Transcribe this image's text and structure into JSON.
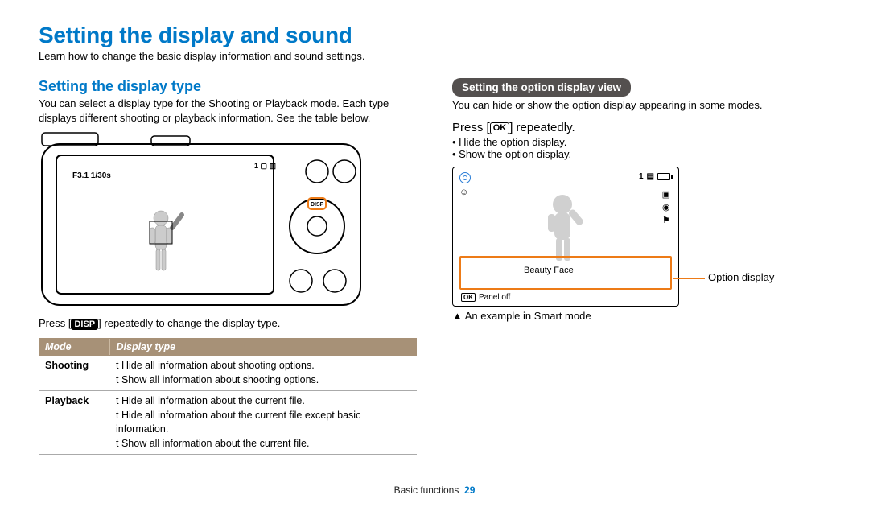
{
  "title": "Setting the display and sound",
  "lead": "Learn how to change the basic display information and sound settings.",
  "left": {
    "subhead": "Setting the display type",
    "para": "You can select a display type for the Shooting or Playback mode. Each type displays different shooting or playback information. See the table below.",
    "camera_overlay": "F3.1 1/30s",
    "disp_label": "DISP",
    "caption_suffix": "] repeatedly to change the display type.",
    "caption_prefix": "Press [",
    "table": {
      "head_mode": "Mode",
      "head_display": "Display type",
      "rows": [
        {
          "mode": "Shooting",
          "items": [
            "Hide all information about shooting options.",
            "Show all information about shooting options."
          ]
        },
        {
          "mode": "Playback",
          "items": [
            "Hide all information about the current file.",
            "Hide all information about the current file except basic information.",
            "Show all information about the current file."
          ]
        }
      ]
    }
  },
  "right": {
    "badge": "Setting the option display view",
    "para": "You can hide or show the option display appearing in some modes.",
    "press_prefix": "Press [",
    "ok_label": "OK",
    "press_suffix": "] repeatedly.",
    "bullets": [
      "Hide the option display.",
      "Show the option display."
    ],
    "screen": {
      "count": "1",
      "beauty": "Beauty Face",
      "panel": "Panel off"
    },
    "option_label": "Option display",
    "example": "▲ An example in Smart mode"
  },
  "footer": {
    "section": "Basic functions",
    "page": "29"
  }
}
